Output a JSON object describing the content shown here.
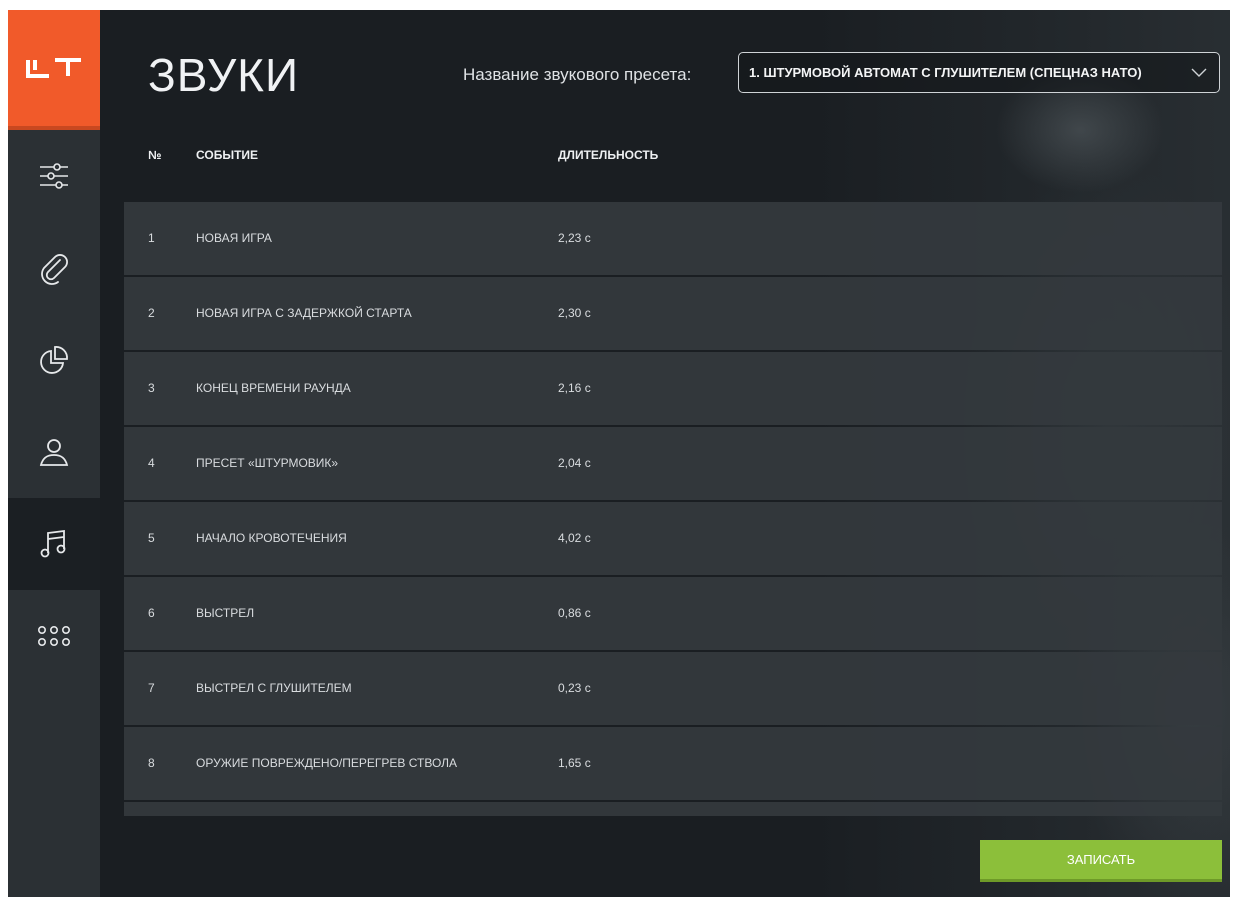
{
  "app": {
    "logo_text": "LT"
  },
  "sidebar": {
    "items": [
      {
        "name": "settings",
        "icon": "sliders-icon",
        "active": false
      },
      {
        "name": "attachments",
        "icon": "paperclip-icon",
        "active": false
      },
      {
        "name": "statistics",
        "icon": "pie-chart-icon",
        "active": false
      },
      {
        "name": "profile",
        "icon": "user-icon",
        "active": false
      },
      {
        "name": "sounds",
        "icon": "music-note-icon",
        "active": true
      },
      {
        "name": "more",
        "icon": "dots-grid-icon",
        "active": false
      }
    ]
  },
  "header": {
    "title": "ЗВУКИ",
    "preset_label": "Название звукового пресета:",
    "preset_value": "1. ШТУРМОВОЙ АВТОМАТ С ГЛУШИТЕЛЕМ (СПЕЦНАЗ НАТО)"
  },
  "table": {
    "columns": {
      "num": "№",
      "event": "СОБЫТИЕ",
      "duration": "ДЛИТЕЛЬНОСТЬ"
    },
    "rows": [
      {
        "num": "1",
        "event": "НОВАЯ ИГРА",
        "duration": "2,23 с"
      },
      {
        "num": "2",
        "event": "НОВАЯ ИГРА С ЗАДЕРЖКОЙ СТАРТА",
        "duration": "2,30 с"
      },
      {
        "num": "3",
        "event": "КОНЕЦ ВРЕМЕНИ РАУНДА",
        "duration": "2,16 с"
      },
      {
        "num": "4",
        "event": "ПРЕСЕТ «ШТУРМОВИК»",
        "duration": "2,04 с"
      },
      {
        "num": "5",
        "event": "НАЧАЛО КРОВОТЕЧЕНИЯ",
        "duration": "4,02 с"
      },
      {
        "num": "6",
        "event": "ВЫСТРЕЛ",
        "duration": "0,86 с"
      },
      {
        "num": "7",
        "event": "ВЫСТРЕЛ С ГЛУШИТЕЛЕМ",
        "duration": "0,23 с"
      },
      {
        "num": "8",
        "event": "ОРУЖИЕ ПОВРЕЖДЕНО/ПЕРЕГРЕВ СТВОЛА",
        "duration": "1,65 с"
      }
    ]
  },
  "actions": {
    "save_label": "ЗАПИСАТЬ"
  },
  "colors": {
    "accent": "#f15a2a",
    "save": "#8cbf3a",
    "sidebar": "#2b3034",
    "background": "#1a1e22"
  }
}
